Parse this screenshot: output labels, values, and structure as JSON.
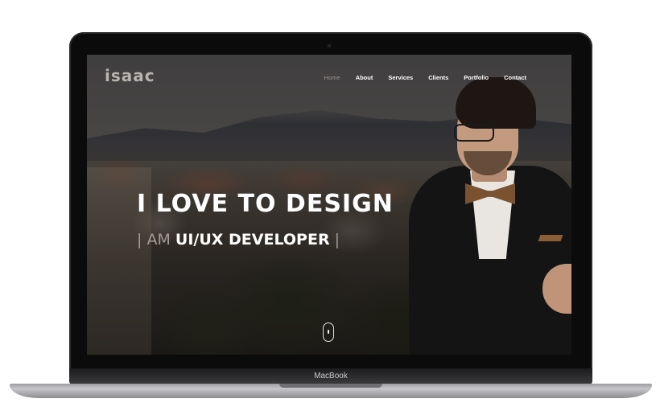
{
  "site": {
    "logo": "isaac",
    "nav": [
      {
        "label": "Home",
        "active": true
      },
      {
        "label": "About",
        "active": false
      },
      {
        "label": "Services",
        "active": false
      },
      {
        "label": "Clients",
        "active": false
      },
      {
        "label": "Portfolio",
        "active": false
      },
      {
        "label": "Contact",
        "active": false
      }
    ],
    "hero": {
      "headline": "I LOVE TO DESIGN",
      "sub_bar_left": "|",
      "sub_prefix": "AM",
      "sub_role": "UI/UX DEVELOPER",
      "sub_bar_right": "|"
    },
    "scroll_icon": "scroll-mouse-icon"
  },
  "device": {
    "brand": "MacBook"
  },
  "colors": {
    "nav_active": "#9c958d",
    "text_light": "#ffffff",
    "text_muted": "#a59d94",
    "bezel": "#0b0b0c",
    "aluminum": "#c6c6ca"
  }
}
